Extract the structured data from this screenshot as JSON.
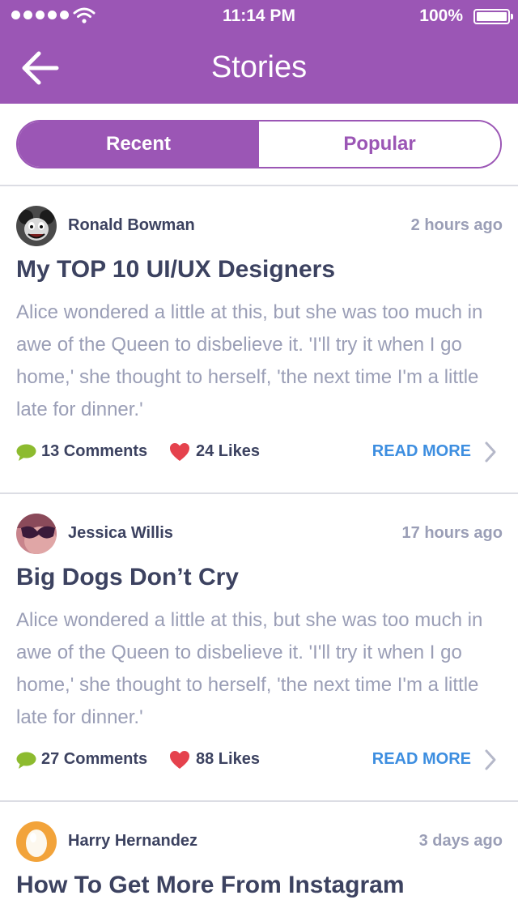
{
  "status_bar": {
    "time": "11:14 PM",
    "battery": "100%"
  },
  "header": {
    "title": "Stories"
  },
  "tabs": [
    {
      "label": "Recent",
      "active": true
    },
    {
      "label": "Popular",
      "active": false
    }
  ],
  "stories": [
    {
      "author": "Ronald Bowman",
      "time": "2 hours ago",
      "title": "My TOP 10 UI/UX Designers",
      "body": "Alice wondered a little at this, but she was too much in awe of the Queen to disbelieve it. 'I'll try it when I go home,' she thought to herself, 'the next time I'm a little late for dinner.'",
      "comments": "13 Comments",
      "likes": "24 Likes",
      "read_more": "READ MORE"
    },
    {
      "author": "Jessica Willis",
      "time": "17 hours ago",
      "title": "Big Dogs Don’t Cry",
      "body": "Alice wondered a little at this, but she was too much in awe of the Queen to disbelieve it. 'I'll try it when I go home,' she thought to herself, 'the next time I'm a little late for dinner.'",
      "comments": "27 Comments",
      "likes": "88 Likes",
      "read_more": "READ MORE"
    },
    {
      "author": "Harry Hernandez",
      "time": "3 days ago",
      "title": "How To Get More From Instagram"
    }
  ],
  "colors": {
    "accent": "#9b56b5",
    "link": "#3d8ee0",
    "comment_icon": "#8dbb2f",
    "heart_icon": "#e5424d",
    "text_dark": "#3c4260",
    "text_muted": "#9a9eb6"
  },
  "icons": {
    "back": "arrow-left-icon",
    "wifi": "wifi-icon",
    "battery": "battery-icon",
    "comment": "speech-bubble-icon",
    "like": "heart-icon",
    "read_more": "chevron-right-icon"
  }
}
